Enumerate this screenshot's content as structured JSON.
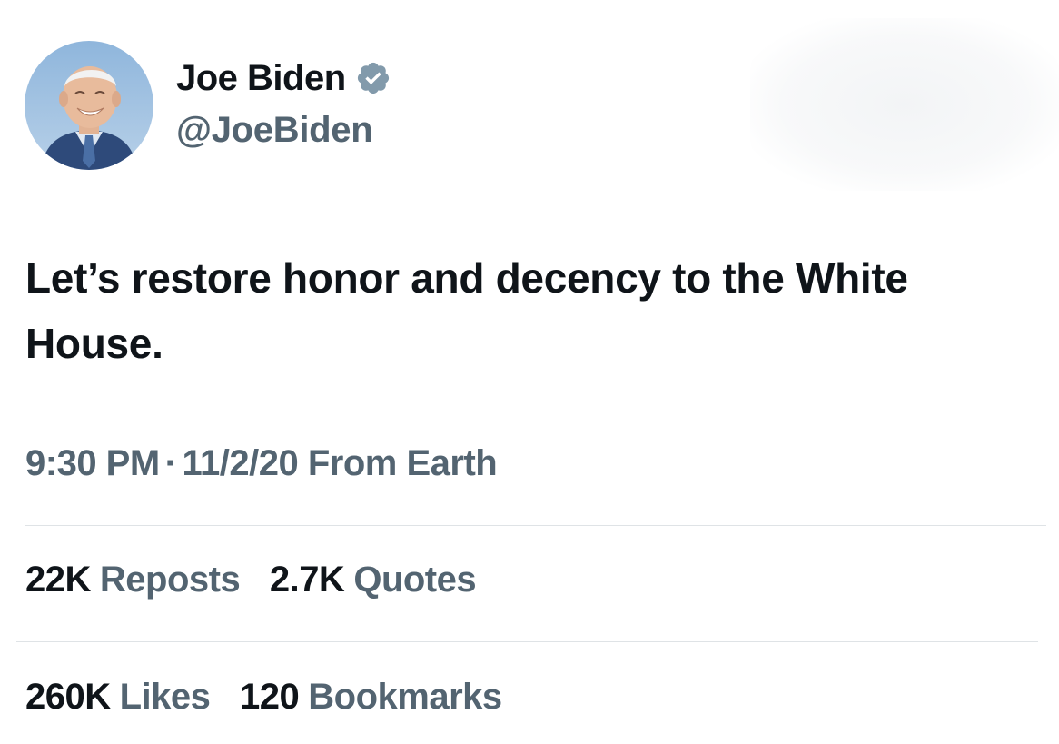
{
  "user": {
    "display_name": "Joe Biden",
    "handle": "@JoeBiden",
    "verified": true
  },
  "tweet": {
    "text": "Let’s restore honor and decency to the White House.",
    "time": "9:30 PM",
    "separator": "·",
    "date": "11/2/20",
    "source": "From Earth"
  },
  "stats": {
    "reposts": {
      "count": "22K",
      "label": "Reposts"
    },
    "quotes": {
      "count": "2.7K",
      "label": "Quotes"
    },
    "likes": {
      "count": "260K",
      "label": "Likes"
    },
    "bookmarks": {
      "count": "120",
      "label": "Bookmarks"
    }
  },
  "colors": {
    "text_primary": "#0f1419",
    "text_secondary": "#536471",
    "verified_badge": "#829aab",
    "divider": "#dfe3e6"
  },
  "icons": {
    "verified": "verified-badge-icon"
  }
}
